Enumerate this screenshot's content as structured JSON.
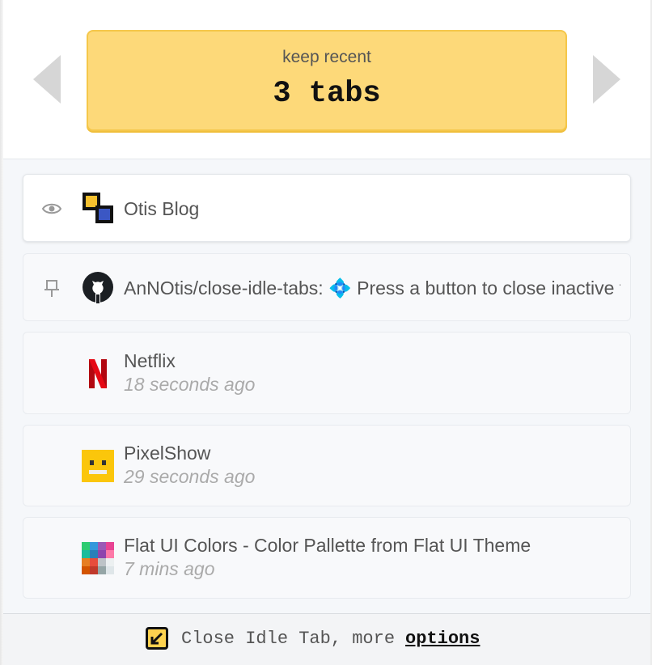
{
  "header": {
    "keep_label": "keep recent",
    "keep_count": "3 tabs",
    "accent_color": "#fdd979"
  },
  "tabs": [
    {
      "title": "Otis Blog",
      "time": "",
      "state_icon": "eye-icon",
      "favicon": "otis-logo-icon",
      "active": true
    },
    {
      "title": "AnNOtis/close-idle-tabs: 💠 Press a button to close inactive tabs",
      "time": "",
      "state_icon": "pin-icon",
      "favicon": "github-icon",
      "active": false
    },
    {
      "title": "Netflix",
      "time": "18 seconds ago",
      "state_icon": "",
      "favicon": "netflix-icon",
      "active": false
    },
    {
      "title": "PixelShow",
      "time": "29 seconds ago",
      "state_icon": "",
      "favicon": "pixelshow-icon",
      "active": false
    },
    {
      "title": "Flat UI Colors - Color Pallette from Flat UI Theme",
      "time": "7 mins ago",
      "state_icon": "",
      "favicon": "flatuicolors-icon",
      "active": false
    }
  ],
  "footer": {
    "text": "Close Idle Tab, more",
    "link_label": "options",
    "icon": "checkbox-icon"
  }
}
